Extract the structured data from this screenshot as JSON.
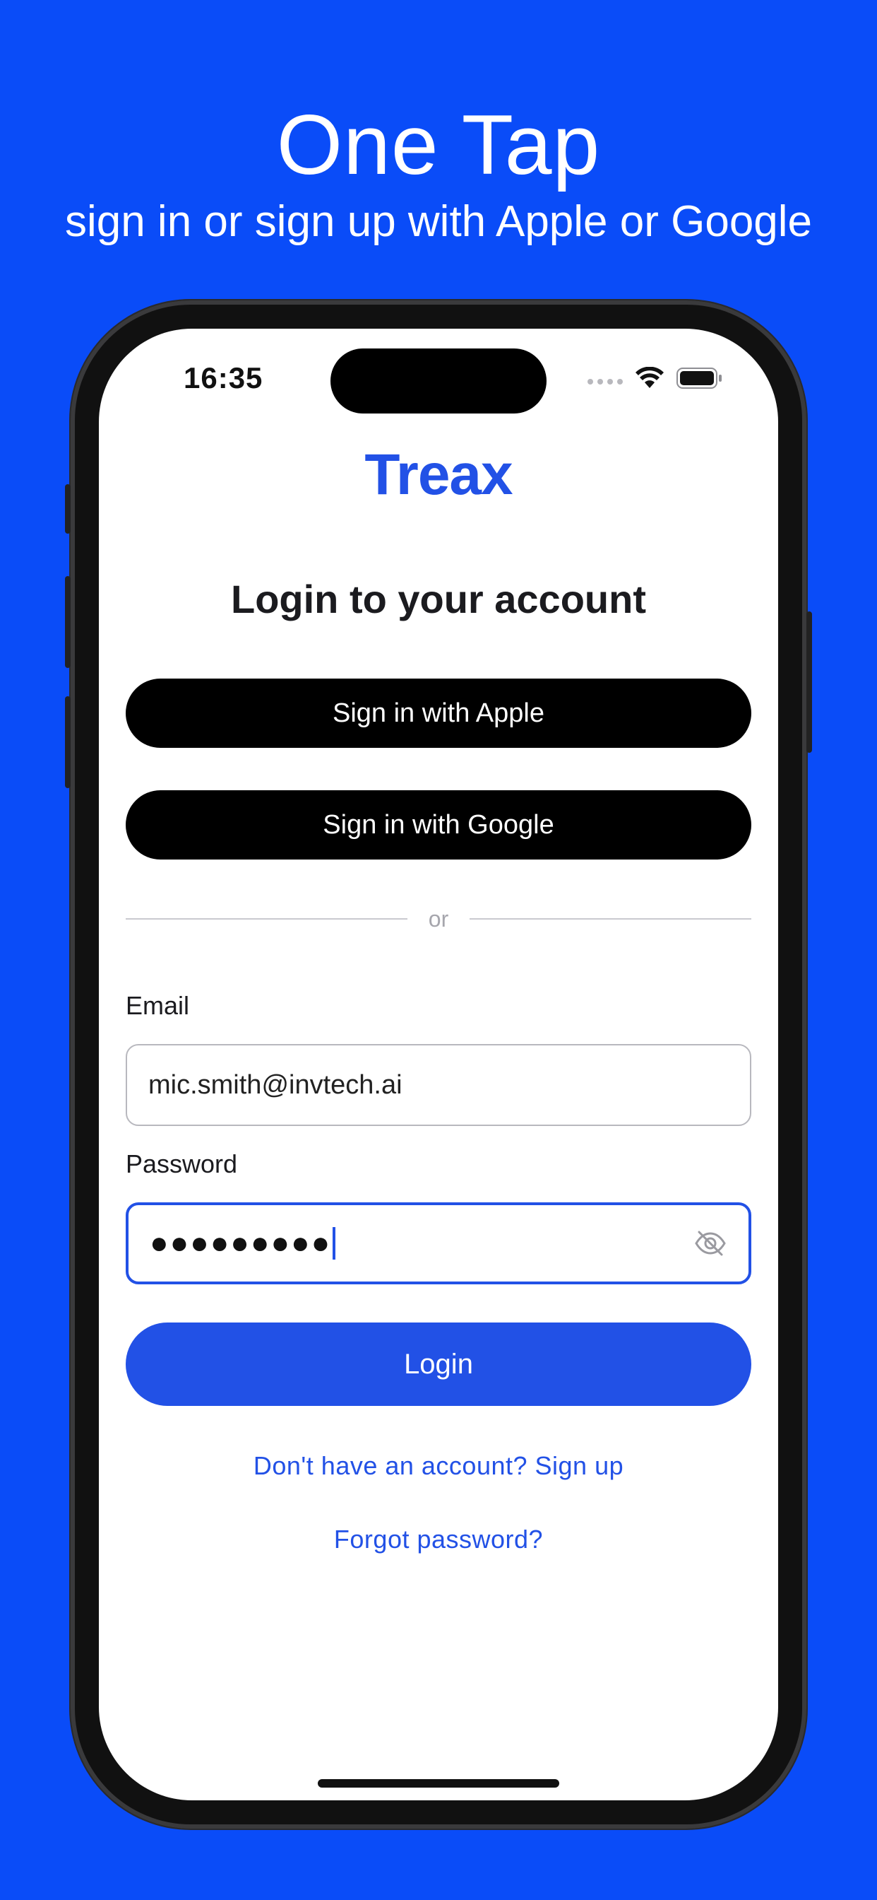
{
  "marketing": {
    "title": "One Tap",
    "subtitle": "sign in or sign up with Apple or Google"
  },
  "status_bar": {
    "time": "16:35"
  },
  "app": {
    "brand": "Treax",
    "heading": "Login to your account"
  },
  "auth": {
    "apple_label": "Sign in with Apple",
    "google_label": "Sign in with Google",
    "divider_text": "or"
  },
  "form": {
    "email_label": "Email",
    "email_value": "mic.smith@invtech.ai",
    "password_label": "Password",
    "password_masked": "●●●●●●●●●",
    "login_label": "Login"
  },
  "links": {
    "signup": "Don't have an account? Sign up",
    "forgot": "Forgot password?"
  },
  "colors": {
    "background": "#0a4cf8",
    "accent": "#2251e6"
  },
  "icons": {
    "password_toggle": "eye-slash-icon",
    "wifi": "wifi-icon",
    "battery": "battery-icon",
    "signal": "signal-dots-icon"
  }
}
